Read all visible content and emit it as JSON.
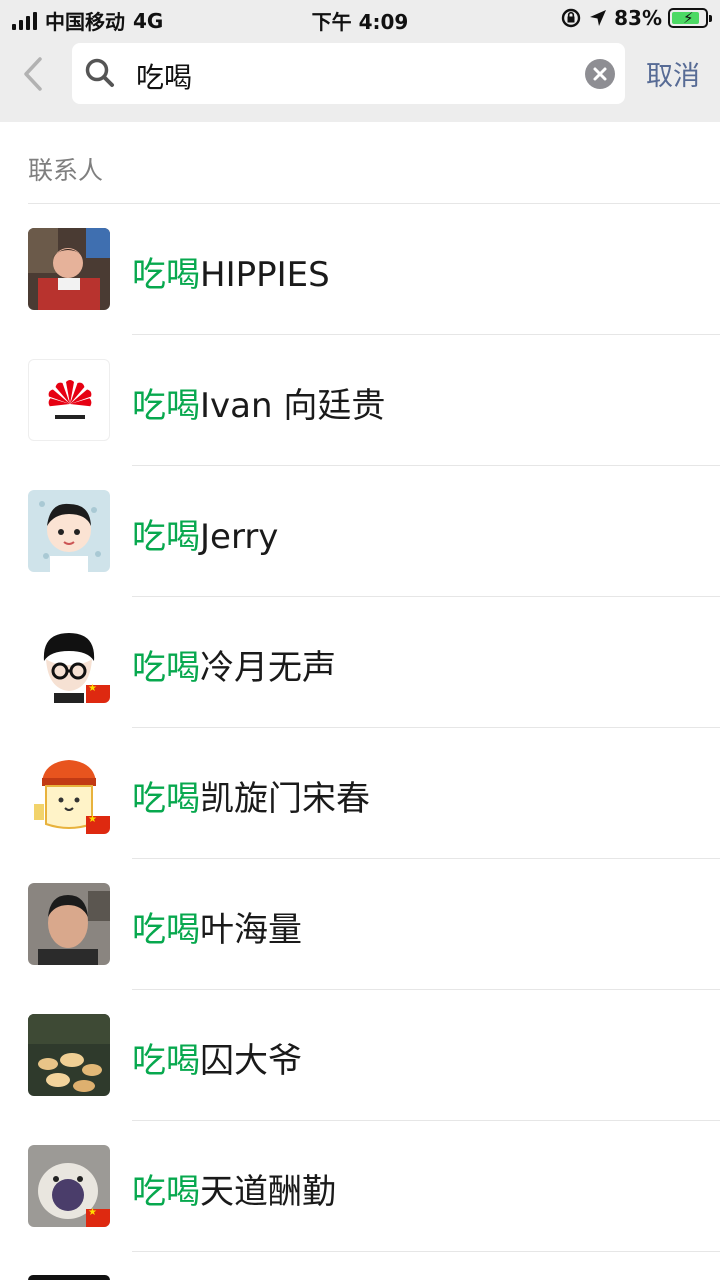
{
  "status_bar": {
    "carrier": "中国移动",
    "network": "4G",
    "time": "下午 4:09",
    "battery": "83%",
    "battery_level": 0.83
  },
  "search": {
    "query": "吃喝",
    "cancel_label": "取消"
  },
  "section_title": "联系人",
  "contacts": [
    {
      "prefix": "吃喝",
      "name": "HIPPIES"
    },
    {
      "prefix": "吃喝",
      "name": "Ivan 向廷贵"
    },
    {
      "prefix": "吃喝",
      "name": "Jerry"
    },
    {
      "prefix": "吃喝",
      "name": "冷月无声"
    },
    {
      "prefix": "吃喝",
      "name": "凯旋门宋春"
    },
    {
      "prefix": "吃喝",
      "name": "叶海量"
    },
    {
      "prefix": "吃喝",
      "name": "囚大爷"
    },
    {
      "prefix": "吃喝",
      "name": "天道酬勤"
    }
  ],
  "colors": {
    "highlight": "#07a84e",
    "link": "#576b95",
    "topbar": "#ededed"
  }
}
